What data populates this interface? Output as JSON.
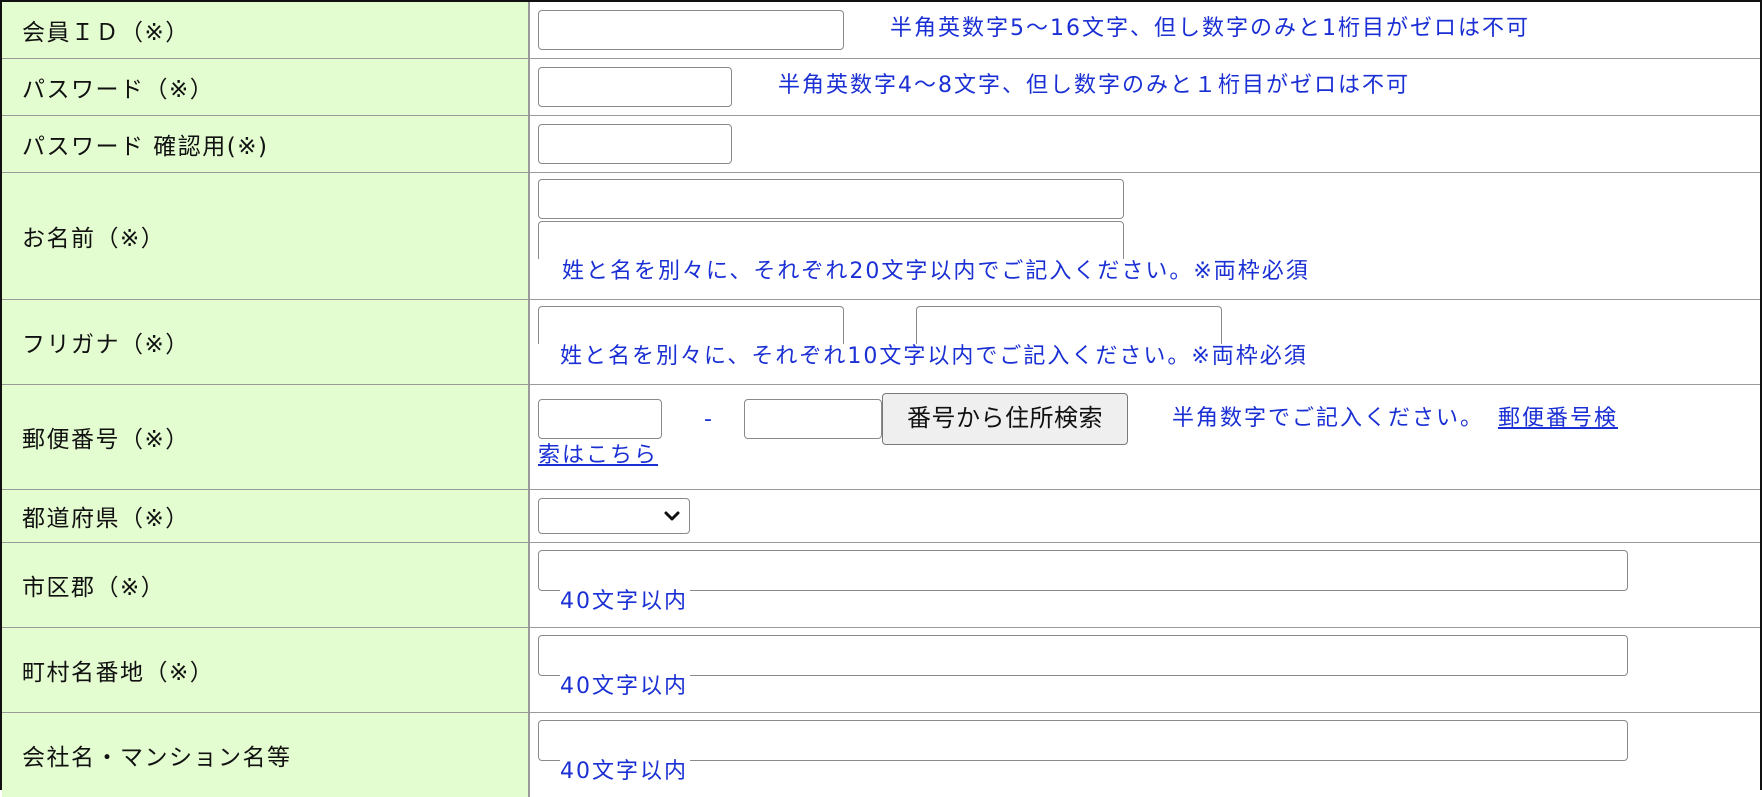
{
  "form": {
    "member_id": {
      "label": "会員ＩＤ（※）",
      "value": "",
      "hint": "半角英数字5～16文字、但し数字のみと1桁目がゼロは不可"
    },
    "password": {
      "label": "パスワード（※）",
      "value": "",
      "hint": "半角英数字4～8文字、但し数字のみと１桁目がゼロは不可"
    },
    "password_confirm": {
      "label": "パスワード 確認用(※)",
      "value": ""
    },
    "name": {
      "label": "お名前（※）",
      "last_value": "",
      "first_value": "",
      "hint": "姓と名を別々に、それぞれ20文字以内でご記入ください。※両枠必須"
    },
    "furigana": {
      "label": "フリガナ（※）",
      "last_value": "",
      "first_value": "",
      "hint": "姓と名を別々に、それぞれ10文字以内でご記入ください。※両枠必須"
    },
    "postal_code": {
      "label": "郵便番号（※）",
      "first_value": "",
      "second_value": "",
      "separator": "-",
      "search_button": "番号から住所検索",
      "hint": "半角数字でご記入ください。",
      "link_text": "郵便番号検索はこちら"
    },
    "prefecture": {
      "label": "都道府県（※）",
      "selected": "",
      "icon": "chevron-down-icon"
    },
    "city": {
      "label": "市区郡（※）",
      "value": "",
      "hint": "40文字以内"
    },
    "street": {
      "label": "町村名番地（※）",
      "value": "",
      "hint": "40文字以内"
    },
    "building": {
      "label": "会社名・マンション名等",
      "value": "",
      "hint": "40文字以内"
    }
  },
  "colors": {
    "label_bg": "#e3fcd0",
    "hint_text": "#1a2fd4",
    "border": "#9a9a9a"
  }
}
